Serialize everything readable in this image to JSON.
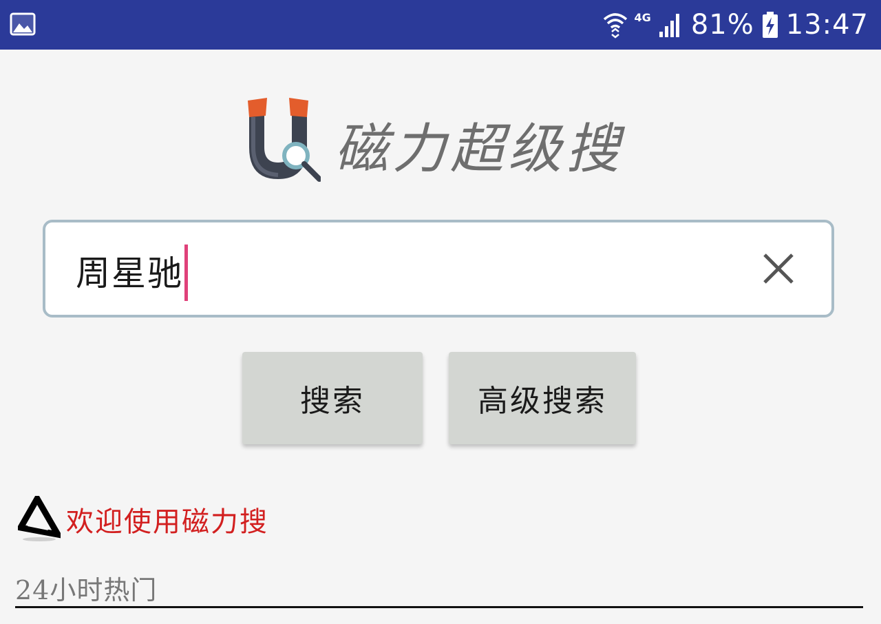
{
  "status_bar": {
    "network_type": "4G",
    "battery": "81%",
    "time": "13:47",
    "icons": [
      "gallery-icon",
      "wifi-icon",
      "signal-icon",
      "battery-charging-icon"
    ],
    "background_color": "#2b3a99"
  },
  "logo": {
    "title": "磁力超级搜",
    "icon": "magnet-search-icon"
  },
  "search": {
    "value": "周星驰",
    "clear_icon": "close-icon",
    "caret_color": "#e0417a"
  },
  "buttons": {
    "search_label": "搜索",
    "advanced_label": "高级搜索"
  },
  "welcome": {
    "text": "欢迎使用磁力搜",
    "icon": "triangle-logo-icon",
    "color": "#d21f1f"
  },
  "hot": {
    "label": "24小时热门"
  }
}
